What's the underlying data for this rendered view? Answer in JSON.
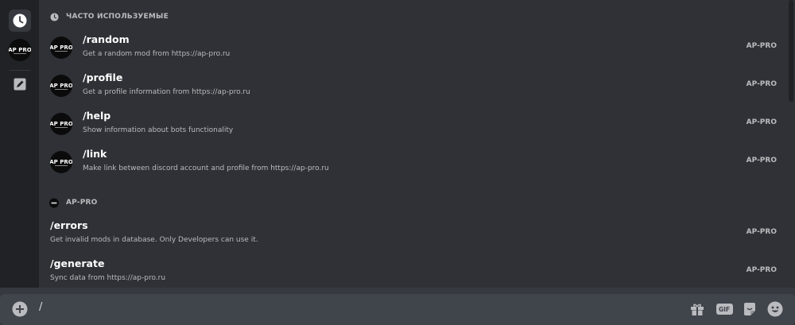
{
  "rail": {
    "items": [
      {
        "icon": "clock-icon",
        "active": true
      },
      {
        "icon": "ap-pro-logo",
        "active": false
      },
      {
        "icon": "edit-icon",
        "active": false
      }
    ]
  },
  "sections": [
    {
      "title": "ЧАСТО ИСПОЛЬЗУЕМЫЕ",
      "icon": "clock-icon"
    },
    {
      "title": "AP-PRO",
      "icon": "ap-pro-logo"
    }
  ],
  "frequent_commands": [
    {
      "name": "/random",
      "description": "Get a random mod from https://ap-pro.ru",
      "source": "AP-PRO"
    },
    {
      "name": "/profile",
      "description": "Get a profile information from https://ap-pro.ru",
      "source": "AP-PRO"
    },
    {
      "name": "/help",
      "description": "Show information about bots functionality",
      "source": "AP-PRO"
    },
    {
      "name": "/link",
      "description": "Make link between discord account and profile from https://ap-pro.ru",
      "source": "AP-PRO"
    }
  ],
  "app_commands": [
    {
      "name": "/errors",
      "description": "Get invalid mods in database. Only Developers can use it.",
      "source": "AP-PRO"
    },
    {
      "name": "/generate",
      "description": "Sync data from https://ap-pro.ru",
      "source": "AP-PRO"
    }
  ],
  "input": {
    "value": "/"
  },
  "input_icons": [
    "add-icon",
    "gift-icon",
    "gif-icon",
    "sticker-icon",
    "emoji-icon"
  ],
  "gif_label": "GIF",
  "logo_text": "AP PRO",
  "colors": {
    "background": "#36393f",
    "popup": "#2f3136",
    "rail": "#202225",
    "input": "#40444b",
    "text": "#dcddde",
    "muted": "#b9bbbe"
  }
}
